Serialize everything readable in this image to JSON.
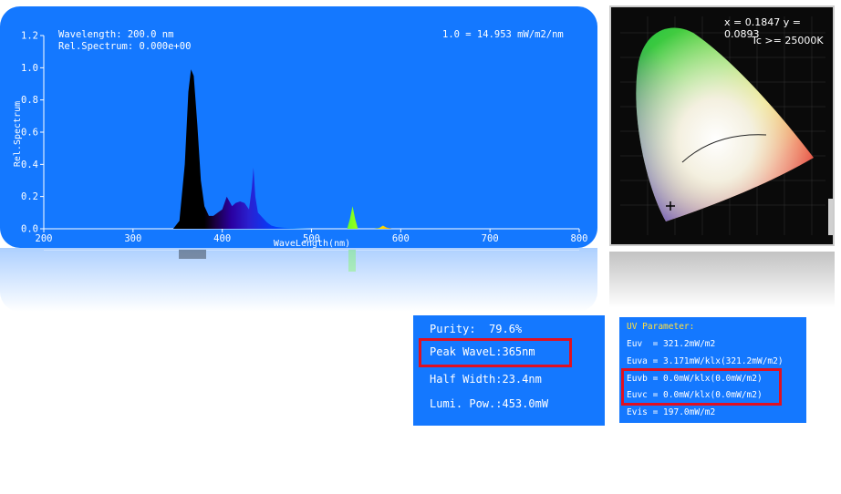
{
  "spectrum": {
    "readout_wavelength": "Wavelength: 200.0 nm",
    "readout_rel_spectrum": "Rel.Spectrum: 0.000e+00",
    "scale_note": "1.0 = 14.953 mW/m2/nm",
    "xlabel": "WaveLength(nm)",
    "ylabel": "Rel.Spectrum"
  },
  "chart_data": {
    "type": "area",
    "title": "",
    "xlabel": "WaveLength(nm)",
    "ylabel": "Rel.Spectrum",
    "xlim": [
      200,
      800
    ],
    "ylim": [
      0,
      1.2
    ],
    "x_ticks": [
      "200",
      "300",
      "400",
      "500",
      "600",
      "700",
      "800"
    ],
    "y_ticks": [
      "0.0",
      "0.2",
      "0.4",
      "0.6",
      "0.8",
      "1.0",
      "1.2"
    ],
    "series": [
      {
        "x": [
          345,
          352,
          358,
          362,
          365,
          368,
          372,
          376,
          380,
          385,
          390,
          395,
          400,
          405,
          408,
          411,
          415,
          420,
          425,
          430,
          433,
          435,
          437,
          440,
          445,
          450,
          455,
          460,
          470,
          480,
          500,
          540,
          543,
          546,
          549,
          552,
          560,
          570,
          576,
          580,
          584,
          590,
          600,
          800
        ],
        "y": [
          0.0,
          0.05,
          0.4,
          0.85,
          0.99,
          0.95,
          0.65,
          0.3,
          0.14,
          0.08,
          0.08,
          0.1,
          0.12,
          0.2,
          0.17,
          0.14,
          0.16,
          0.17,
          0.16,
          0.12,
          0.25,
          0.38,
          0.2,
          0.1,
          0.07,
          0.04,
          0.02,
          0.012,
          0.006,
          0.003,
          0.0,
          0.0,
          0.06,
          0.14,
          0.06,
          0.0,
          0.0,
          0.0,
          0.005,
          0.02,
          0.008,
          0.0,
          0.0,
          0.0
        ]
      }
    ],
    "grid": false
  },
  "cie": {
    "readout_xy": "x = 0.1847  y = 0.0893",
    "readout_tc": "Tc >= 25000K"
  },
  "parameters": {
    "purity": "Purity:  79.6%",
    "peak_wavelength": "Peak WaveL:365nm",
    "half_width": "Half Width:23.4nm",
    "lumi_power": "Lumi. Pow.:453.0mW"
  },
  "uv_parameter": {
    "title": "UV Parameter:",
    "euv": "Euv  = 321.2mW/m2",
    "euva": "Euva = 3.171mW/klx(321.2mW/m2)",
    "euvb": "Euvb = 0.0mW/klx(0.0mW/m2)",
    "euvc": "Euvc = 0.0mW/klx(0.0mW/m2)",
    "evis": "Evis = 197.0mW/m2"
  },
  "colors": {
    "panel_blue": "#1478ff",
    "highlight_red": "#e01020",
    "uv_title_yellow": "#ffe040"
  }
}
